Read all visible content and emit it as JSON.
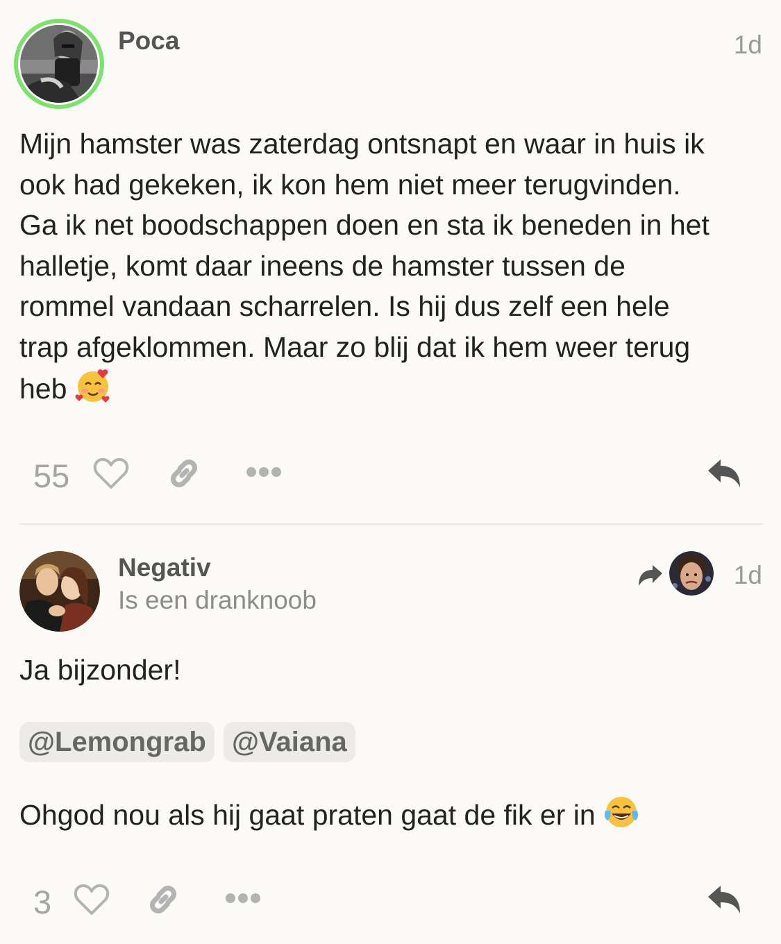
{
  "posts": [
    {
      "username": "Poca",
      "date": "1d",
      "body_lines": [
        "Mijn hamster was zaterdag ontsnapt en waar in huis ik",
        "ook had gekeken, ik kon hem niet meer terugvinden.",
        "Ga ik net boodschappen doen en sta ik beneden in het",
        "halletje, komt daar ineens de hamster tussen de",
        "rommel vandaan scharrelen. Is hij dus zelf een hele",
        "trap afgeklommen. Maar zo blij dat ik hem weer terug",
        "heb"
      ],
      "body_emoji": "smiling-face-with-hearts",
      "like_count": "55",
      "avatar_ring_color": "#7be36a"
    },
    {
      "username": "Negativ",
      "user_title": "Is een dranknoob",
      "date": "1d",
      "reply_text": "Ja bijzonder!",
      "mentions": [
        "@Lemongrab",
        "@Vaiana"
      ],
      "closing_text": "Ohgod nou als hij gaat praten gaat de fik er in",
      "closing_emoji": "face-with-tears-of-joy",
      "like_count": "3"
    }
  ],
  "colors": {
    "background": "#fcfaf7",
    "text": "#222222",
    "muted": "#9a9a9a",
    "icon": "#b3b3b3",
    "reply_icon": "#555555"
  }
}
